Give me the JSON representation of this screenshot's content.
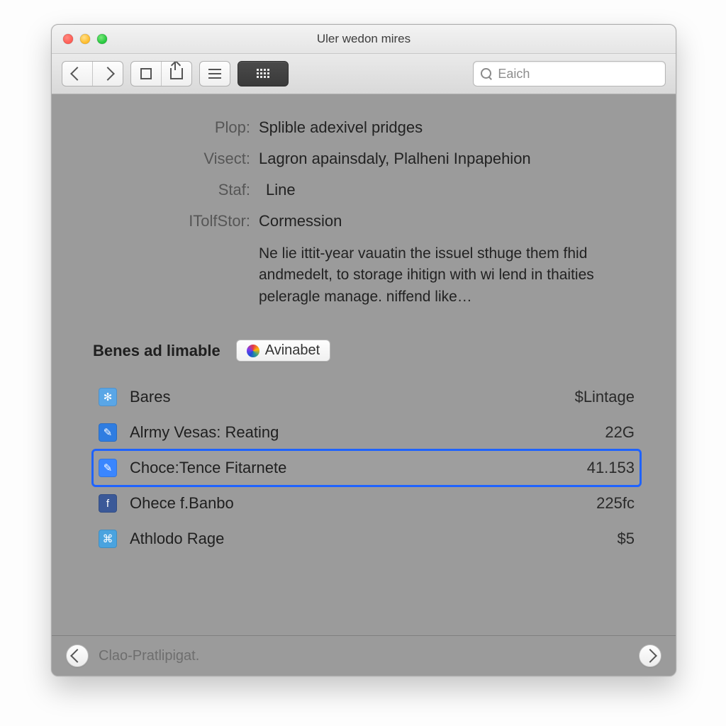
{
  "window": {
    "title": "Uler wedon mires"
  },
  "toolbar": {
    "search_placeholder": "Eaich"
  },
  "info": {
    "label_plop": "Plop:",
    "value_plop": "Splible adexivel pridges",
    "label_visect": "Visect:",
    "value_visect": "Lagron apainsdaly, Plalheni Inpapehion",
    "label_staf": "Staf:",
    "value_staf": "Line",
    "label_tolstor": "ITolfStor:",
    "value_tolstor": "Cormession",
    "description": "Ne lie ittit-year vauatin the issuel sthuge them fhid andmedelt, to storage ihitign with wi lend in thaities peleragle manage. niffend like…"
  },
  "section": {
    "heading": "Benes ad limable",
    "pill_label": "Avinabet"
  },
  "items": [
    {
      "name": "Bares",
      "size": "$Lintage",
      "icon_bg": "#5aa6e6",
      "glyph": "✻",
      "selected": false
    },
    {
      "name": "Alrmy Vesas: Reating",
      "size": "22G",
      "icon_bg": "#2f7de1",
      "glyph": "✎",
      "selected": false
    },
    {
      "name": "Choce:Tence Fitarnete",
      "size": "41.153",
      "icon_bg": "#3a86ff",
      "glyph": "✎",
      "selected": true
    },
    {
      "name": "Ohece f.Banbo",
      "size": "225fc",
      "icon_bg": "#3b5998",
      "glyph": "f",
      "selected": false
    },
    {
      "name": "Athlodo Rage",
      "size": "$5",
      "icon_bg": "#4aa3df",
      "glyph": "⌘",
      "selected": false
    }
  ],
  "footer": {
    "text": "Clao-Pratlipigat."
  }
}
